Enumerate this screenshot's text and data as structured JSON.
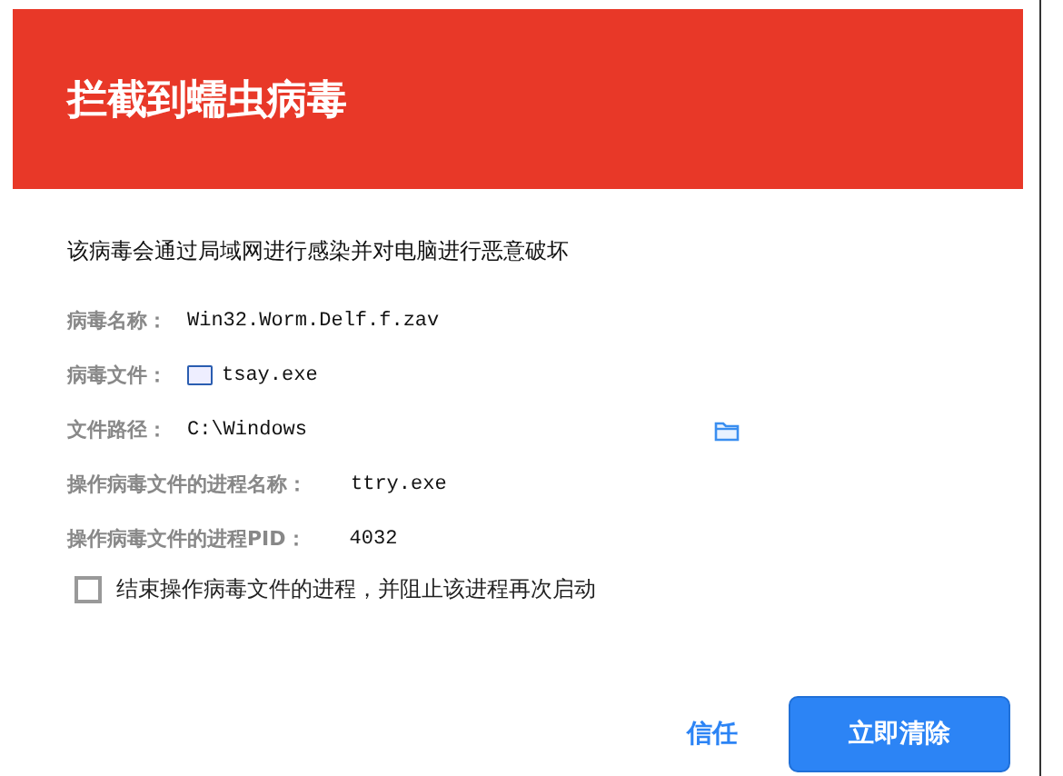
{
  "title": "拦截到蠕虫病毒",
  "description": "该病毒会通过局域网进行感染并对电脑进行恶意破坏",
  "fields": [
    {
      "label": "病毒名称：",
      "value": "Win32.Worm.Delf.f.zav",
      "kind": "text"
    },
    {
      "label": "病毒文件：",
      "value": "tsay.exe",
      "kind": "file"
    },
    {
      "label": "文件路径：",
      "value": "C:\\Windows",
      "kind": "path"
    },
    {
      "label": "操作病毒文件的进程名称：",
      "value": "ttry.exe",
      "kind": "text"
    },
    {
      "label": "操作病毒文件的进程PID：",
      "value": "4032",
      "kind": "text"
    }
  ],
  "option": {
    "label": "结束操作病毒文件的进程，并阻止该进程再次启动",
    "checked": false
  },
  "buttons": [
    {
      "label": "信任",
      "kind": "link"
    },
    {
      "label": "立即清除",
      "kind": "primary"
    }
  ]
}
